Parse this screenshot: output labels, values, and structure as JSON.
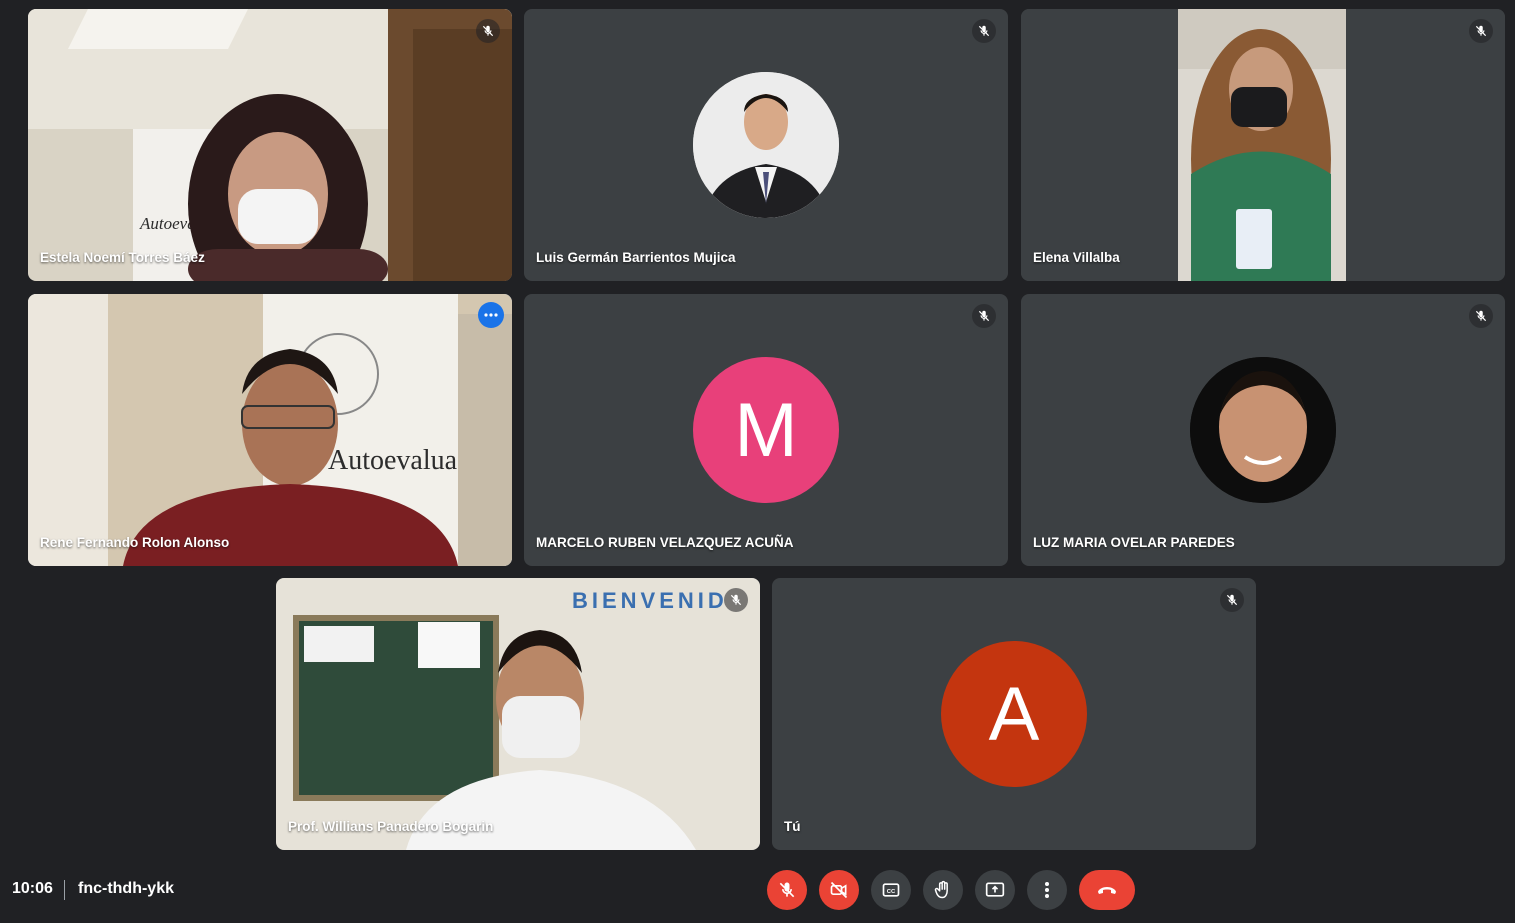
{
  "participants": [
    {
      "name": "Estela Noemí Torres Báez",
      "video": true,
      "muted": true
    },
    {
      "name": "Luis Germán Barrientos Mujica",
      "video": false,
      "muted": true
    },
    {
      "name": "Elena Villalba",
      "video": true,
      "muted": true
    },
    {
      "name": "Rene Fernando Rolon Alonso",
      "video": true,
      "muted": false,
      "active_speaker": true
    },
    {
      "name": "MARCELO RUBEN VELAZQUEZ ACUÑA",
      "video": false,
      "muted": true,
      "initial": "M",
      "avatar_color": "#e8407a"
    },
    {
      "name": "LUZ MARIA OVELAR PAREDES",
      "video": false,
      "muted": true
    },
    {
      "name": "Prof. Willians Panadero Bogarin",
      "video": true,
      "muted": true
    },
    {
      "name": "Tú",
      "video": false,
      "muted": true,
      "initial": "A",
      "avatar_color": "#c4350f"
    }
  ],
  "scene_text": {
    "banner_estela": "Autoevaluación Acreditación",
    "banner_rene": "Autoevaluación",
    "bienvenidos": "BIENVENID"
  },
  "meeting": {
    "time": "10:06",
    "code": "fnc-thdh-ykk"
  },
  "controls": [
    {
      "name": "microphone-off",
      "state": "off"
    },
    {
      "name": "camera-off",
      "state": "off"
    },
    {
      "name": "captions",
      "state": "normal"
    },
    {
      "name": "raise-hand",
      "state": "normal"
    },
    {
      "name": "present-now",
      "state": "normal"
    },
    {
      "name": "more-options",
      "state": "normal"
    },
    {
      "name": "leave-call",
      "state": "end"
    }
  ],
  "colors": {
    "background": "#202124",
    "tile": "#3c4043",
    "accent_blue": "#1a73e8",
    "active_outline": "#8ab4f8",
    "danger_red": "#ea4335"
  }
}
